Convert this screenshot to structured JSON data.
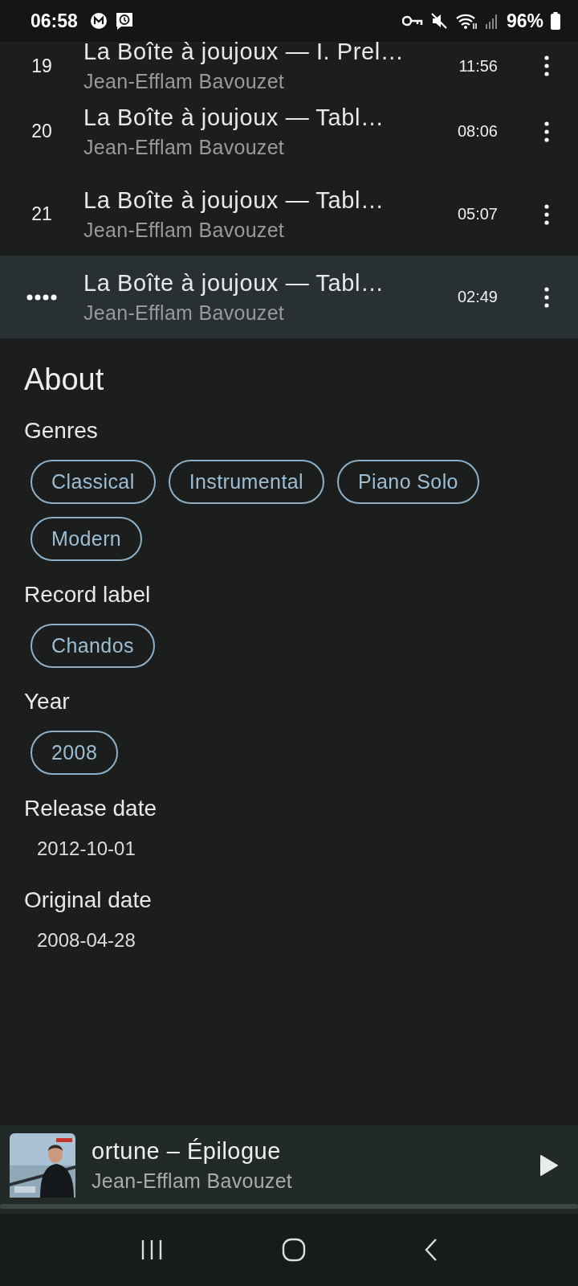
{
  "status_bar": {
    "time": "06:58",
    "battery": "96%"
  },
  "tracks": [
    {
      "number": "19",
      "title": "La Boîte à joujoux — I. Prel…",
      "artist": "Jean-Efflam Bavouzet",
      "duration": "11:56",
      "playing": false
    },
    {
      "number": "20",
      "title": "La Boîte à joujoux — Tabl…",
      "artist": "Jean-Efflam Bavouzet",
      "duration": "08:06",
      "playing": false
    },
    {
      "number": "21",
      "title": "La Boîte à joujoux — Tabl…",
      "artist": "Jean-Efflam Bavouzet",
      "duration": "05:07",
      "playing": false
    },
    {
      "title": "La Boîte à joujoux — Tabl…",
      "artist": "Jean-Efflam Bavouzet",
      "duration": "02:49",
      "playing": true
    }
  ],
  "about": {
    "title": "About",
    "sections": [
      {
        "heading": "Genres",
        "kind": "chips",
        "items": [
          "Classical",
          "Instrumental",
          "Piano Solo",
          "Modern"
        ]
      },
      {
        "heading": "Record label",
        "kind": "chips",
        "items": [
          "Chandos"
        ]
      },
      {
        "heading": "Year",
        "kind": "chips",
        "items": [
          "2008"
        ]
      },
      {
        "heading": "Release date",
        "kind": "text",
        "items": [
          "2012-10-01"
        ]
      },
      {
        "heading": "Original date",
        "kind": "text",
        "items": [
          "2008-04-28"
        ]
      }
    ]
  },
  "now_playing": {
    "title": "ortune – Épilogue",
    "artist": "Jean-Efflam Bavouzet"
  }
}
